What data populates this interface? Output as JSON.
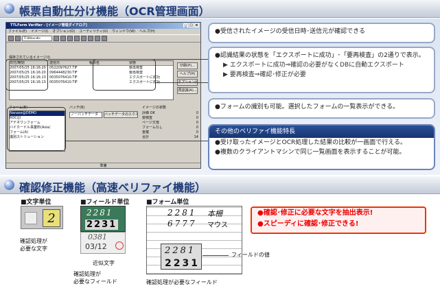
{
  "top_banner": {
    "title": "帳票自動仕分け機能（OCR管理画面）"
  },
  "bottom_banner": {
    "title": "確認修正機能（高速ベリファイ機能）"
  },
  "app": {
    "title": "TTLForm Verifier - [イメージ管理ダイアログ]",
    "menu": [
      "ファイル(E)",
      "イメージ(I)",
      "オプション(O)",
      "ユーティリティ(U)",
      "ウィンドウ(W)",
      "ヘルプ(H)"
    ],
    "combo": "TT-BKbundle",
    "list_label": "保存されているイメージ(I)",
    "columns": [
      "日付/時刻",
      "送信元",
      "帳票名",
      "状態"
    ],
    "rows": [
      [
        "2007/05/25 16:16:20",
        "0522097627.TIF",
        "",
        "要再検査"
      ],
      [
        "2007/05/25 16:16:20",
        "0964448230.TIF",
        "",
        "要再検査"
      ],
      [
        "2007/05/25 16:16:13",
        "0035076410.TIF",
        "",
        "エクスポートに成功"
      ],
      [
        "2007/05/25 16:16:13",
        "0035076410.TIF",
        "",
        "エクスポートに成功"
      ]
    ],
    "buttons": [
      "印刷(P)...",
      "ヘルプ(H)",
      "オプション(O)",
      "再認識(A)..."
    ],
    "forms_label": "フォーム(E)",
    "forms": [
      "Nanase@DEMO",
      "ROC(J)",
      "アテネワンフォーム",
      "バイカードル事業所(Asia)",
      "フォーム(A)",
      "識別ストリューション"
    ],
    "batch_label": "バッチ(B)",
    "batch_value": "ノーバッチデータ",
    "batch_button": "バッチデータのエクスポート(X)",
    "status_label": "イメージの状態",
    "status_items": [
      [
        "評価 OK",
        "0"
      ],
      [
        "要検査",
        "0"
      ],
      [
        "ページ欠落",
        "0"
      ],
      [
        "フォームなし",
        "0"
      ],
      [
        "重複",
        "0"
      ],
      [
        "合計",
        "14"
      ]
    ],
    "statusbar": "準備"
  },
  "callouts": {
    "c1": "●受信されたイメージの受信日時･送信元が確認できる",
    "c2": "●認識結果の状態を「エクスポートに成功」･「要再検査」の2通りで表示。",
    "c2a": "▶ エクスポートに成功⇒確認の必要がなくDBに自動エクスポート",
    "c2b": "▶ 要再検査⇒確認･修正が必要",
    "c3": "●フォームの識別も可能。選択したフォームの一覧表示ができる。",
    "c4_title": "その他のベリファイ機能特長",
    "c4a": "●受け取ったイメージとOCR処理した結果の比較が一画面で行える。",
    "c4b": "●複数のクライアントマシンで同じ一覧画面を表示することが可能。"
  },
  "verify": {
    "char_unit": "■文字単位",
    "field_unit": "■フィールド単位",
    "form_unit": "■フォーム単位",
    "char_label": "確認処理が\n必要な文字",
    "approx_label": "近似文字",
    "field_label": "確認処理が\n必要なフィールド",
    "form_label": "確認処理が必要なフィールド",
    "field_value_label": "フィールドの値",
    "hw1": "2",
    "hw_num": "2281",
    "ocr_num": "2231",
    "field_line1": "0381",
    "field_line2": "03/12",
    "form_cells": [
      "2281",
      "本柵",
      "6777",
      "マウス"
    ],
    "red1": "●確認･修正に必要な文字を抽出表示!",
    "red2": "●スピーディに確認･修正できる!"
  }
}
